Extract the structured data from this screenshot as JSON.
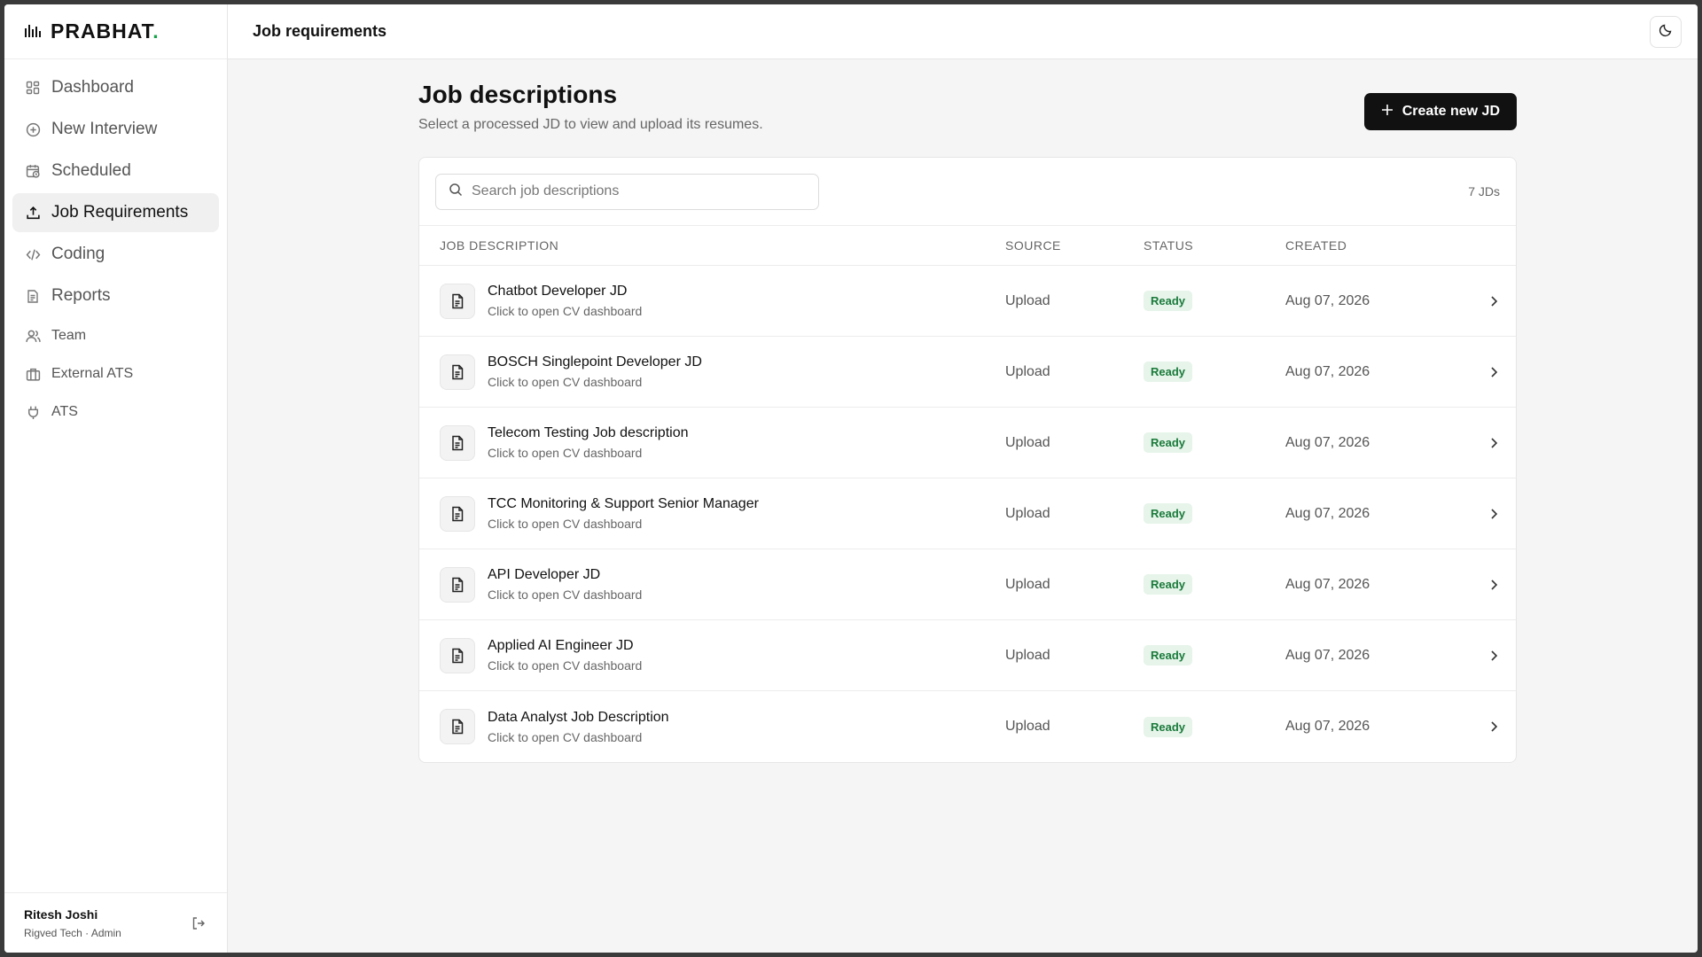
{
  "brand": {
    "name": "PRABHAT",
    "dot": ".",
    "icon": "bar-chart-icon"
  },
  "sidebar": {
    "items": [
      {
        "label": "Dashboard",
        "icon": "dashboard-icon",
        "active": false
      },
      {
        "label": "New Interview",
        "icon": "plus-circle-icon",
        "active": false
      },
      {
        "label": "Scheduled",
        "icon": "calendar-clock-icon",
        "active": false
      },
      {
        "label": "Job Requirements",
        "icon": "upload-icon",
        "active": true
      },
      {
        "label": "Coding",
        "icon": "code-icon",
        "active": false
      },
      {
        "label": "Reports",
        "icon": "document-icon",
        "active": false
      },
      {
        "label": "Team",
        "icon": "users-icon",
        "active": false
      },
      {
        "label": "External ATS",
        "icon": "briefcase-icon",
        "active": false
      },
      {
        "label": "ATS",
        "icon": "plug-icon",
        "active": false
      }
    ]
  },
  "user": {
    "name": "Ritesh Joshi",
    "meta": "Rigved Tech · Admin"
  },
  "topbar": {
    "title": "Job requirements"
  },
  "page": {
    "title": "Job descriptions",
    "subtitle": "Select a processed JD to view and upload its resumes.",
    "create_label": "Create new JD"
  },
  "search": {
    "placeholder": "Search job descriptions",
    "value": ""
  },
  "count": "7 JDs",
  "table": {
    "headers": {
      "jd": "Job description",
      "source": "Source",
      "status": "Status",
      "created": "Created"
    },
    "rows": [
      {
        "title": "Chatbot Developer JD",
        "sub": "Click to open CV dashboard",
        "source": "Upload",
        "status": "Ready",
        "created": "Aug 07, 2026"
      },
      {
        "title": "BOSCH Singlepoint Developer JD",
        "sub": "Click to open CV dashboard",
        "source": "Upload",
        "status": "Ready",
        "created": "Aug 07, 2026"
      },
      {
        "title": "Telecom Testing Job description",
        "sub": "Click to open CV dashboard",
        "source": "Upload",
        "status": "Ready",
        "created": "Aug 07, 2026"
      },
      {
        "title": "TCC Monitoring & Support Senior Manager",
        "sub": "Click to open CV dashboard",
        "source": "Upload",
        "status": "Ready",
        "created": "Aug 07, 2026"
      },
      {
        "title": "API Developer JD",
        "sub": "Click to open CV dashboard",
        "source": "Upload",
        "status": "Ready",
        "created": "Aug 07, 2026"
      },
      {
        "title": "Applied AI Engineer JD",
        "sub": "Click to open CV dashboard",
        "source": "Upload",
        "status": "Ready",
        "created": "Aug 07, 2026"
      },
      {
        "title": "Data Analyst Job Description",
        "sub": "Click to open CV dashboard",
        "source": "Upload",
        "status": "Ready",
        "created": "Aug 07, 2026"
      }
    ]
  },
  "colors": {
    "accent": "#111111",
    "brand_dot": "#16a34a",
    "ready_bg": "#e6f4ea",
    "ready_fg": "#1a7a3a"
  }
}
